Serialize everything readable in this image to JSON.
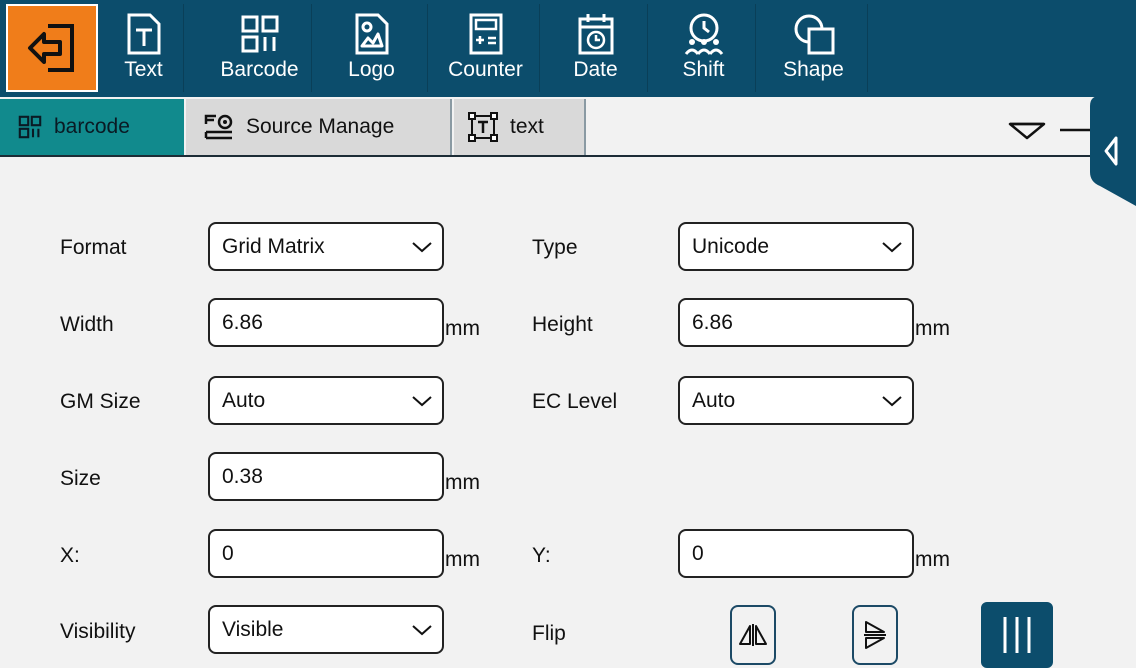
{
  "toolbar": {
    "back_icon": "exit-icon",
    "items": [
      {
        "label": "Text",
        "icon": "text-icon"
      },
      {
        "label": "Barcode",
        "icon": "barcode-icon"
      },
      {
        "label": "Logo",
        "icon": "logo-icon"
      },
      {
        "label": "Counter",
        "icon": "counter-icon"
      },
      {
        "label": "Date",
        "icon": "calendar-icon"
      },
      {
        "label": "Shift",
        "icon": "shift-icon"
      },
      {
        "label": "Shape",
        "icon": "shape-icon"
      }
    ]
  },
  "tabs": [
    {
      "label": "barcode",
      "icon": "barcode-icon",
      "active": true
    },
    {
      "label": "Source Manage",
      "icon": "source-manage-icon",
      "active": false
    },
    {
      "label": "text",
      "icon": "text-frame-icon",
      "active": false
    }
  ],
  "form": {
    "format": {
      "label": "Format",
      "value": "Grid Matrix"
    },
    "type": {
      "label": "Type",
      "value": "Unicode"
    },
    "width": {
      "label": "Width",
      "value": "6.86",
      "unit": "mm"
    },
    "height": {
      "label": "Height",
      "value": "6.86",
      "unit": "mm"
    },
    "gm_size": {
      "label": "GM Size",
      "value": "Auto"
    },
    "ec_level": {
      "label": "EC Level",
      "value": "Auto"
    },
    "size": {
      "label": "Size",
      "value": "0.38",
      "unit": "mm"
    },
    "x": {
      "label": "X:",
      "value": "0",
      "unit": "mm"
    },
    "y": {
      "label": "Y:",
      "value": "0",
      "unit": "mm"
    },
    "visibility": {
      "label": "Visibility",
      "value": "Visible"
    },
    "flip": {
      "label": "Flip"
    }
  },
  "colors": {
    "toolbar_bg": "#0c4d6c",
    "back_accent": "#f07d1a",
    "active_tab": "#118a8d"
  }
}
